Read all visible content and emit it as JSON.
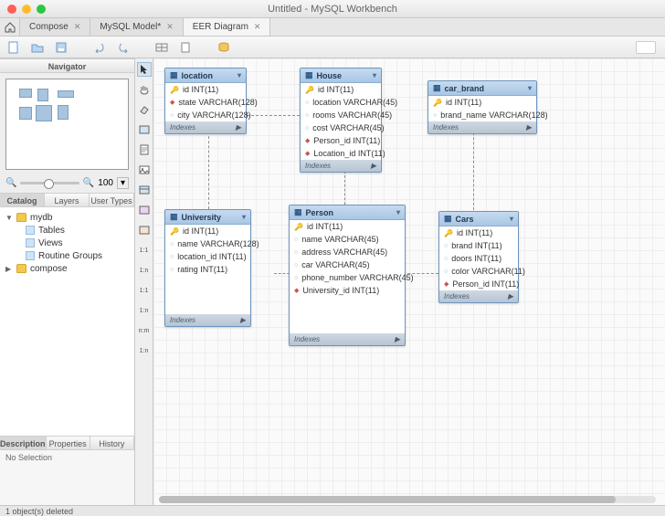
{
  "window": {
    "title": "Untitled - MySQL Workbench"
  },
  "tabs": [
    {
      "label": "Compose",
      "active": false
    },
    {
      "label": "MySQL Model*",
      "active": false
    },
    {
      "label": "EER Diagram",
      "active": true
    }
  ],
  "sidebar": {
    "nav_title": "Navigator",
    "zoom_value": "100",
    "catalog_tabs": [
      "Catalog",
      "Layers",
      "User Types"
    ],
    "tree": {
      "db": "mydb",
      "children": [
        "Tables",
        "Views",
        "Routine Groups"
      ],
      "db2": "compose"
    },
    "prop_tabs": [
      "Description",
      "Properties",
      "History"
    ],
    "no_selection": "No Selection"
  },
  "mid_tools": {
    "labels": [
      "1:1",
      "1:n",
      "1:1",
      "1:n",
      "n:m",
      "1:n"
    ]
  },
  "entities": {
    "location": {
      "name": "location",
      "cols": [
        {
          "k": "key",
          "t": "id INT(11)"
        },
        {
          "k": "dia",
          "t": "state VARCHAR(128)"
        },
        {
          "k": "circ",
          "t": "city VARCHAR(128)"
        }
      ],
      "idx": "Indexes"
    },
    "house": {
      "name": "House",
      "cols": [
        {
          "k": "key",
          "t": "id INT(11)"
        },
        {
          "k": "circ",
          "t": "location VARCHAR(45)"
        },
        {
          "k": "circ",
          "t": "rooms VARCHAR(45)"
        },
        {
          "k": "circ",
          "t": "cost VARCHAR(45)"
        },
        {
          "k": "dia",
          "t": "Person_id INT(11)"
        },
        {
          "k": "dia",
          "t": "Location_id INT(11)"
        }
      ],
      "idx": "Indexes"
    },
    "car_brand": {
      "name": "car_brand",
      "cols": [
        {
          "k": "key",
          "t": "id INT(11)"
        },
        {
          "k": "circ",
          "t": "brand_name VARCHAR(128)"
        }
      ],
      "idx": "Indexes"
    },
    "university": {
      "name": "University",
      "cols": [
        {
          "k": "key",
          "t": "id INT(11)"
        },
        {
          "k": "circ",
          "t": "name VARCHAR(128)"
        },
        {
          "k": "circ",
          "t": "location_id INT(11)"
        },
        {
          "k": "circ",
          "t": "rating INT(11)"
        }
      ],
      "idx": "Indexes"
    },
    "person": {
      "name": "Person",
      "cols": [
        {
          "k": "key",
          "t": "id INT(11)"
        },
        {
          "k": "circ",
          "t": "name VARCHAR(45)"
        },
        {
          "k": "circ",
          "t": "address VARCHAR(45)"
        },
        {
          "k": "circ",
          "t": "car VARCHAR(45)"
        },
        {
          "k": "circ",
          "t": "phone_number VARCHAR(45)"
        },
        {
          "k": "dia",
          "t": "University_id INT(11)"
        }
      ],
      "idx": "Indexes"
    },
    "cars": {
      "name": "Cars",
      "cols": [
        {
          "k": "key",
          "t": "id INT(11)"
        },
        {
          "k": "circ",
          "t": "brand INT(11)"
        },
        {
          "k": "circ",
          "t": "doors INT(11)"
        },
        {
          "k": "circ",
          "t": "color VARCHAR(11)"
        },
        {
          "k": "dia",
          "t": "Person_id INT(11)"
        }
      ],
      "idx": "Indexes"
    }
  },
  "status": {
    "text": "1 object(s) deleted"
  }
}
